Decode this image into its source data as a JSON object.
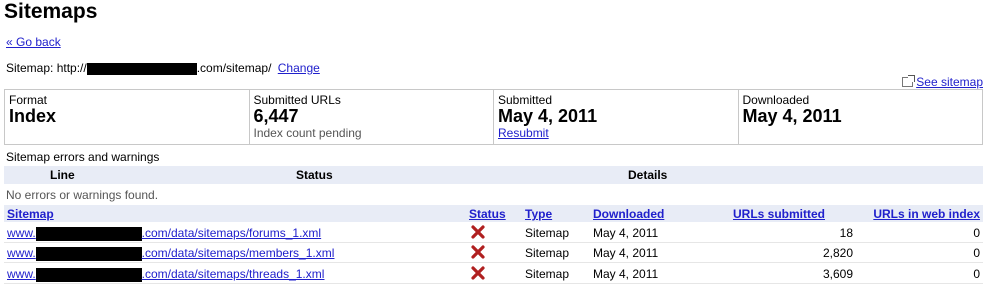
{
  "page": {
    "title": "Sitemaps",
    "go_back": "« Go back"
  },
  "sitemap": {
    "label": "Sitemap: http://",
    "suffix": ".com/sitemap/",
    "change": "Change",
    "see_sitemap": "See sitemap"
  },
  "summary": [
    {
      "label": "Format",
      "value": "Index",
      "sub": ""
    },
    {
      "label": "Submitted URLs",
      "value": "6,447",
      "sub": "Index count pending"
    },
    {
      "label": "Submitted",
      "value": "May 4, 2011",
      "sub": "Resubmit"
    },
    {
      "label": "Downloaded",
      "value": "May 4, 2011",
      "sub": ""
    }
  ],
  "errors": {
    "heading": "Sitemap errors and warnings",
    "columns": {
      "line": "Line",
      "status": "Status",
      "details": "Details"
    },
    "empty": "No errors or warnings found."
  },
  "table": {
    "columns": {
      "sitemap": "Sitemap",
      "status": "Status",
      "type": "Type",
      "downloaded": "Downloaded",
      "urls_submitted": "URLs submitted",
      "urls_indexed": "URLs in web index"
    },
    "rows": [
      {
        "prefix": "www.",
        "path": ".com/data/sitemaps/forums_1.xml",
        "type": "Sitemap",
        "downloaded": "May 4, 2011",
        "submitted": "18",
        "indexed": "0"
      },
      {
        "prefix": "www.",
        "path": ".com/data/sitemaps/members_1.xml",
        "type": "Sitemap",
        "downloaded": "May 4, 2011",
        "submitted": "2,820",
        "indexed": "0"
      },
      {
        "prefix": "www.",
        "path": ".com/data/sitemaps/threads_1.xml",
        "type": "Sitemap",
        "downloaded": "May 4, 2011",
        "submitted": "3,609",
        "indexed": "0"
      }
    ]
  },
  "colors": {
    "link": "#2020cc",
    "header_bg": "#e8ecf6",
    "error_red": "#b02020"
  }
}
